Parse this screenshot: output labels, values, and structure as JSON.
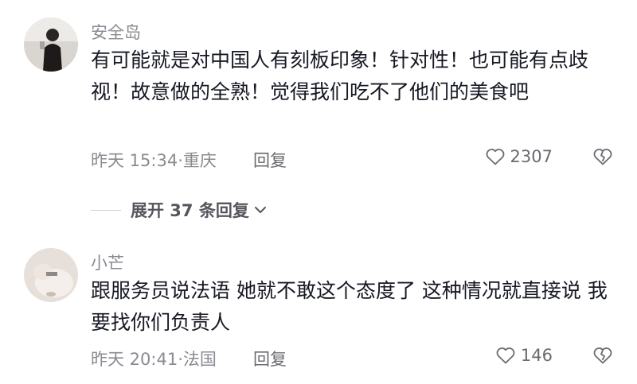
{
  "comments": [
    {
      "username": "安全岛",
      "text": "有可能就是对中国人有刻板印象！针对性！也可能有点歧视！故意做的全熟！觉得我们吃不了他们的美食吧",
      "time": "昨天 15:34",
      "location": "重庆",
      "reply_label": "回复",
      "likes": "2307",
      "avatar_icon": "user-avatar-photo-dark"
    },
    {
      "username": "小芒",
      "text": "跟服务员说法语 她就不敢这个态度了 这种情况就直接说 我要找你们负责人",
      "time": "昨天 20:41",
      "location": "法国",
      "reply_label": "回复",
      "likes": "146",
      "avatar_icon": "user-avatar-photo-light"
    }
  ],
  "expand_replies": {
    "label": "展开 37 条回复"
  },
  "colors": {
    "text": "#161823",
    "secondary": "#8a8b91",
    "action": "#6a6b71"
  }
}
